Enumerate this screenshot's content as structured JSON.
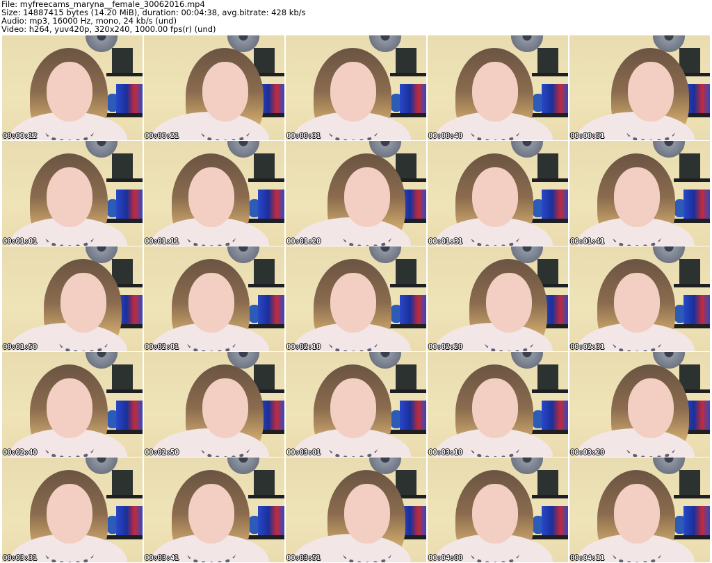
{
  "info": {
    "file": "File: myfreecams_maryna__female_30062016.mp4",
    "size": "Size: 14887415 bytes (14.20 MiB), duration: 00:04:38, avg.bitrate: 428 kb/s",
    "audio": "Audio: mp3, 16000 Hz, mono, 24 kb/s (und)",
    "video": "Video: h264, yuv420p, 320x240, 1000.00 fps(r) (und)"
  },
  "thumbnails": [
    "00:00:12",
    "00:00:21",
    "00:00:31",
    "00:00:40",
    "00:00:51",
    "00:01:01",
    "00:01:11",
    "00:01:20",
    "00:01:31",
    "00:01:41",
    "00:01:50",
    "00:02:01",
    "00:02:10",
    "00:02:20",
    "00:02:31",
    "00:02:40",
    "00:02:50",
    "00:03:01",
    "00:03:10",
    "00:03:20",
    "00:03:31",
    "00:03:41",
    "00:03:51",
    "00:04:00",
    "00:04:11"
  ]
}
